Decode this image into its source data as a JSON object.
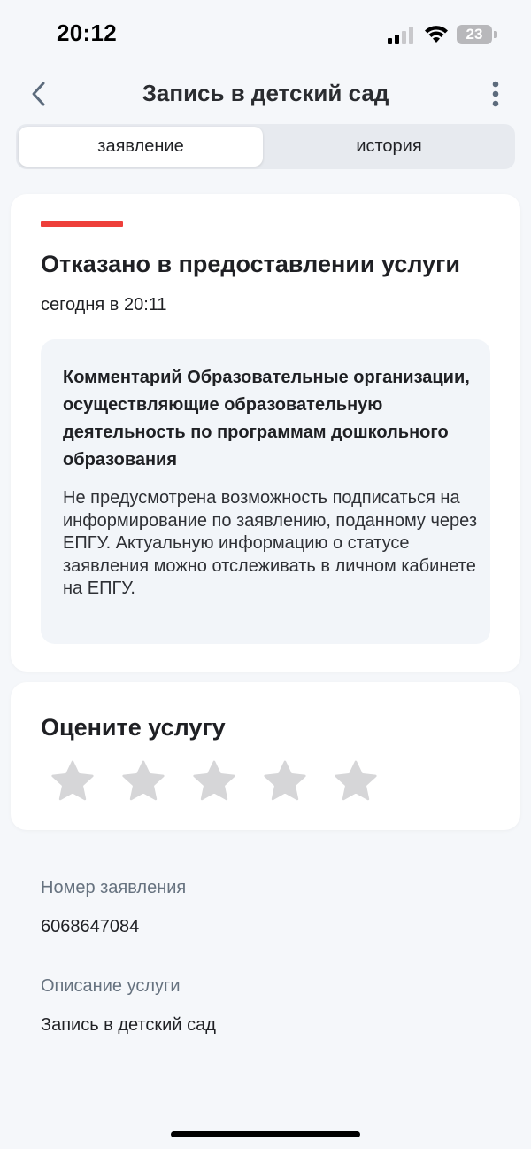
{
  "status_bar": {
    "time": "20:12",
    "battery": "23"
  },
  "header": {
    "title": "Запись в детский сад",
    "back_icon": "chevron-left-icon",
    "more_icon": "more-vertical-icon"
  },
  "tabs": [
    {
      "label": "заявление",
      "active": true
    },
    {
      "label": "история",
      "active": false
    }
  ],
  "status_card": {
    "heading": "Отказано в предоставлении услуги",
    "date": "сегодня в 20:11",
    "accent_color": "#ee3f3a",
    "comment": {
      "title": "Комментарий Образовательные организации, осуществляющие образовательную деятельность по программам дошкольного образования",
      "body": "Не предусмотрена возможность подписаться на информирование по заявлению, поданному через ЕПГУ. Актуальную информацию о статусе заявления можно отслеживать в личном кабинете на ЕПГУ."
    }
  },
  "rating": {
    "title": "Оцените услугу",
    "star_icon": "star-icon",
    "stars_max": 5,
    "stars_selected": 0
  },
  "info": {
    "number_label": "Номер заявления",
    "number_value": "6068647084",
    "description_label": "Описание услуги",
    "description_value": "Запись в детский сад"
  },
  "colors": {
    "background": "#f5f7fa",
    "card": "#ffffff",
    "comment_bg": "#f2f5f9",
    "star_inactive": "#d6d6d8",
    "label": "#66727f"
  }
}
